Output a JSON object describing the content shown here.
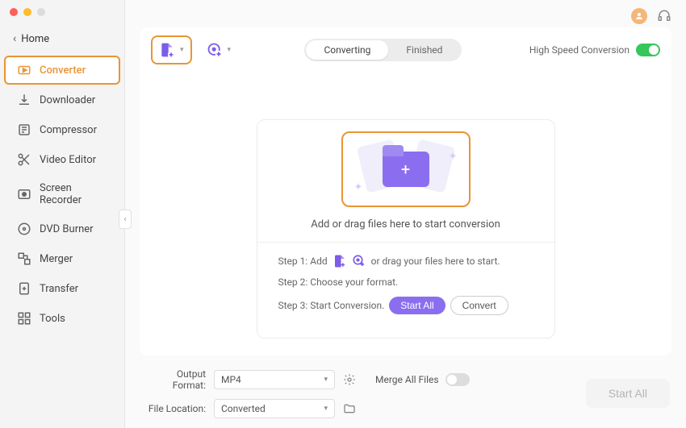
{
  "sidebar": {
    "home_label": "Home",
    "items": [
      {
        "label": "Converter"
      },
      {
        "label": "Downloader"
      },
      {
        "label": "Compressor"
      },
      {
        "label": "Video Editor"
      },
      {
        "label": "Screen Recorder"
      },
      {
        "label": "DVD Burner"
      },
      {
        "label": "Merger"
      },
      {
        "label": "Transfer"
      },
      {
        "label": "Tools"
      }
    ]
  },
  "toolbar": {
    "tabs": {
      "converting": "Converting",
      "finished": "Finished"
    },
    "high_speed_label": "High Speed Conversion"
  },
  "dropzone": {
    "text": "Add or drag files here to start conversion",
    "step1_prefix": "Step 1: Add",
    "step1_suffix": "or drag your files here to start.",
    "step2": "Step 2: Choose your format.",
    "step3_prefix": "Step 3: Start Conversion.",
    "start_all": "Start  All",
    "convert": "Convert"
  },
  "bottom": {
    "output_format_label": "Output Format:",
    "output_format_value": "MP4",
    "file_location_label": "File Location:",
    "file_location_value": "Converted",
    "merge_label": "Merge All Files",
    "start_all": "Start All"
  }
}
